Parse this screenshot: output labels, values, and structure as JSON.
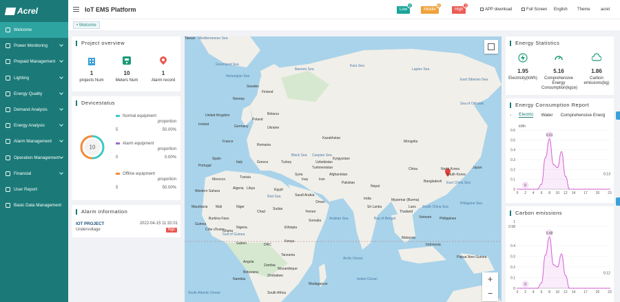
{
  "sidebar": {
    "logo": "Acrel",
    "items": [
      {
        "label": "Welcome",
        "icon": "home-icon",
        "active": true,
        "chevron": false
      },
      {
        "label": "Power Monitoring",
        "icon": "monitor-icon",
        "chevron": true
      },
      {
        "label": "Prepaid Management",
        "icon": "wallet-icon",
        "chevron": true
      },
      {
        "label": "Lighting",
        "icon": "bulb-icon",
        "chevron": true
      },
      {
        "label": "Energy Quality",
        "icon": "quality-icon",
        "chevron": true
      },
      {
        "label": "Demand Analysis",
        "icon": "chart-icon",
        "chevron": true
      },
      {
        "label": "Energy Analysis",
        "icon": "analysis-icon",
        "chevron": true
      },
      {
        "label": "Alarm Management",
        "icon": "bell-icon",
        "chevron": true
      },
      {
        "label": "Operation Management",
        "icon": "gear-icon",
        "chevron": true
      },
      {
        "label": "Financial",
        "icon": "finance-icon",
        "chevron": true
      },
      {
        "label": "User Report",
        "icon": "report-icon",
        "chevron": false
      },
      {
        "label": "Basic Data Management",
        "icon": "data-icon",
        "chevron": false
      }
    ]
  },
  "header": {
    "title": "IoT EMS Platform",
    "badges": [
      {
        "label": "Low",
        "count": "0",
        "color": "#1aa59a",
        "count_color": "#1aa59a"
      },
      {
        "label": "Middle",
        "count": "0",
        "color": "#f0a13a",
        "count_color": "#f0a13a"
      },
      {
        "label": "High",
        "count": "1",
        "color": "#ec5b55",
        "count_color": "#ec5b55"
      }
    ],
    "app_download": "APP download",
    "full_screen": "Full Screen",
    "language": "English",
    "theme": "Theme",
    "user": "acrel"
  },
  "tags": {
    "welcome": "Welcome"
  },
  "project_overview": {
    "title": "Project overview",
    "items": [
      {
        "value": "1",
        "label": "projects Num",
        "icon": "building-icon",
        "color": "#3aa0d8"
      },
      {
        "value": "10",
        "label": "Meters Num",
        "icon": "meter-icon",
        "color": "#1b9a78"
      },
      {
        "value": "1",
        "label": "Alarm record",
        "icon": "alarm-pin-icon",
        "color": "#e9574f"
      }
    ]
  },
  "device_status": {
    "title": "Devicestatus",
    "total": "10",
    "rows": [
      {
        "label": "Normal equipment",
        "label2": "proportion",
        "value": "5",
        "percent": "50.00%",
        "color": "#3ec9c5",
        "share": 0.5
      },
      {
        "label": "Alarm equipment",
        "label2": "proportion",
        "value": "0",
        "percent": "0.00%",
        "color": "#9a6fc7",
        "share": 0
      },
      {
        "label": "Offline equipment",
        "label2": "proportion",
        "value": "5",
        "percent": "50.00%",
        "color": "#f08a3a",
        "share": 0.5
      }
    ]
  },
  "alarm_info": {
    "title": "Alarm information",
    "project": "IOT PROJECT",
    "time": "2022-04-15 11:32:01",
    "type": "Undervoltage",
    "level": "High"
  },
  "map": {
    "labels": [
      "Greenland Sea",
      "Norwegian Sea",
      "Sweden",
      "Finland",
      "Norway",
      "Barents Sea",
      "Kara Sea",
      "Laptev Sea",
      "East Siberian Sea",
      "United Kingdom",
      "Ireland",
      "Germany",
      "Poland",
      "Belarus",
      "France",
      "Ukraine",
      "Romania",
      "Kazakhstan",
      "Mongolia",
      "Spain",
      "Portugal",
      "Italy",
      "Greece",
      "Turkey",
      "Uzbekistan",
      "Kyrgyzstan",
      "Turkmenistan",
      "China",
      "North Korea",
      "South Korea",
      "Japan",
      "Tunisia",
      "Morocco",
      "Algeria",
      "Libya",
      "Egypt",
      "Syria",
      "Iraq",
      "Iran",
      "Afghanistan",
      "Pakistan",
      "Nepal",
      "Western Sahara",
      "Mauritania",
      "Mali",
      "Niger",
      "Chad",
      "Sudan",
      "Saudi Arabia",
      "Oman",
      "India",
      "Myanmar (Burma)",
      "Laos",
      "Thailand",
      "Vietnam",
      "Philippines",
      "Philippine Sea",
      "South China Sea",
      "Bay of Bengal",
      "Arabian Sea",
      "Yemen",
      "Ethiopia",
      "Somalia",
      "Kenya",
      "Nigeria",
      "Burkina Faso",
      "Guinea",
      "Côte d'Ivoire",
      "Ghana",
      "Gulf of Guinea",
      "Gabon",
      "DRC",
      "Tanzania",
      "Angola",
      "Zambia",
      "Zimbabwe",
      "Mozambique",
      "Namibia",
      "Botswana",
      "Madagascar",
      "South Africa",
      "Malaysia",
      "Indonesia",
      "Papua New Guinea",
      "Indian Ocean",
      "South Atlantic Ocean",
      "Sea of Okhotsk",
      "East China Sea",
      "Black Sea",
      "Caspian Sea",
      "Red Sea",
      "Mediterranean Sea",
      "Arctic Ocean",
      "Sri Lanka",
      "Bangladesh",
      "Taiwan"
    ],
    "zoom_in": "+",
    "zoom_out": "−"
  },
  "energy_statistics": {
    "title": "Energy Statistics",
    "items": [
      {
        "value": "1.95",
        "label": "Electricity(kWh)",
        "icon": "bolt-icon"
      },
      {
        "value": "5.16",
        "label": "Comprehensive Energy Consumption(kgce)",
        "icon": "gauge-icon"
      },
      {
        "value": "1.86",
        "label": "Carbon emissions(kg)",
        "icon": "co2-icon"
      }
    ]
  },
  "energy_report": {
    "title": "Energy Consumption Report",
    "tabs": [
      "Electric",
      "Water",
      "Comprehensive Energ"
    ],
    "active_tab": 0
  },
  "carbon": {
    "title": "Carbon emissions"
  },
  "chart_data": [
    {
      "type": "area",
      "unit": "kWh",
      "x": [
        0,
        1,
        2,
        3,
        4,
        5,
        6,
        7,
        8,
        9,
        10,
        11,
        12,
        13,
        14,
        15,
        16,
        17,
        18,
        19,
        20,
        21,
        22,
        23
      ],
      "values": [
        0,
        0,
        0,
        0,
        0,
        0,
        0.05,
        0.32,
        0.51,
        0.25,
        0.22,
        0.38,
        0.13,
        0,
        0,
        0,
        0,
        0,
        0,
        0,
        0,
        0,
        0,
        0
      ],
      "ylim": [
        0,
        0.6
      ],
      "yticks": [
        0,
        0.1,
        0.2,
        0.3,
        0.4,
        0.5,
        0.6
      ],
      "xticks": [
        0,
        2,
        4,
        6,
        8,
        10,
        12,
        14,
        17,
        20,
        23
      ],
      "annotations": [
        {
          "x": 8,
          "label": "0.51"
        },
        {
          "x": 2,
          "label": "0"
        },
        {
          "x": 12,
          "label": "0.13"
        }
      ],
      "color": "#d461d4"
    },
    {
      "type": "area",
      "x": [
        0,
        1,
        2,
        3,
        4,
        5,
        6,
        7,
        8,
        9,
        10,
        11,
        12,
        13,
        14,
        15,
        16,
        17,
        18,
        19,
        20,
        21,
        22,
        23
      ],
      "values": [
        0,
        0,
        0,
        0,
        0,
        0,
        0.05,
        0.31,
        0.48,
        0.22,
        0.2,
        0.32,
        0.12,
        0,
        0,
        0,
        0,
        0,
        0,
        0,
        0,
        0,
        0,
        0
      ],
      "ylim": [
        0,
        0.58
      ],
      "yticks": [
        0,
        0.1,
        0.2,
        0.3,
        0.4,
        0.58
      ],
      "ytick_labels": [
        "0",
        "0.1",
        "0.2",
        "0.3",
        "0.4",
        "0.58"
      ],
      "top_label": "1",
      "xticks": [
        0,
        2,
        4,
        6,
        8,
        10,
        12,
        14,
        17,
        20,
        23
      ],
      "annotations": [
        {
          "x": 8,
          "label": "0.48"
        },
        {
          "x": 2,
          "label": "0"
        },
        {
          "x": 12,
          "label": "0.12"
        }
      ],
      "color": "#d461d4"
    }
  ]
}
